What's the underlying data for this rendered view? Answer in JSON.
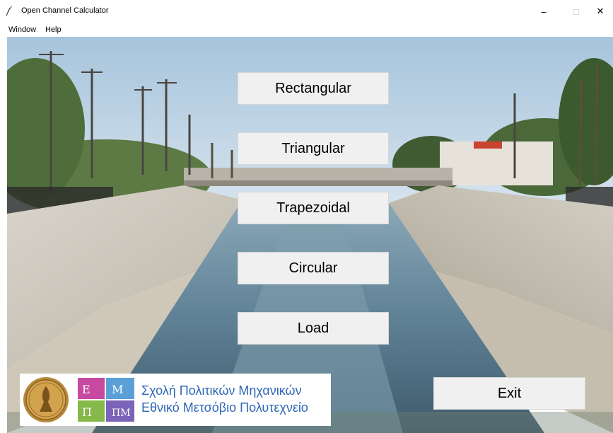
{
  "window": {
    "title": "Open Channel Calculator",
    "controls": {
      "minimize": "–",
      "maximize": "□",
      "close": "✕"
    }
  },
  "menubar": {
    "items": [
      "Window",
      "Help"
    ]
  },
  "main": {
    "buttons": [
      "Rectangular",
      "Triangular",
      "Trapezoidal",
      "Circular",
      "Load"
    ],
    "exit_label": "Exit",
    "background": "photo of a concrete flood-control channel with water running through it, bridge and palm trees in the distance"
  },
  "logo": {
    "line1": "Σχολή Πολιτικών Μηχανικών",
    "line2": "Εθνικό Μετσόβιο Πολυτεχνείο",
    "mark_text": "ΕΜΠ",
    "text_color": "#2f67b7"
  },
  "colors": {
    "button_bg": "#f0f0f0",
    "button_border": "#d6d6d6"
  }
}
